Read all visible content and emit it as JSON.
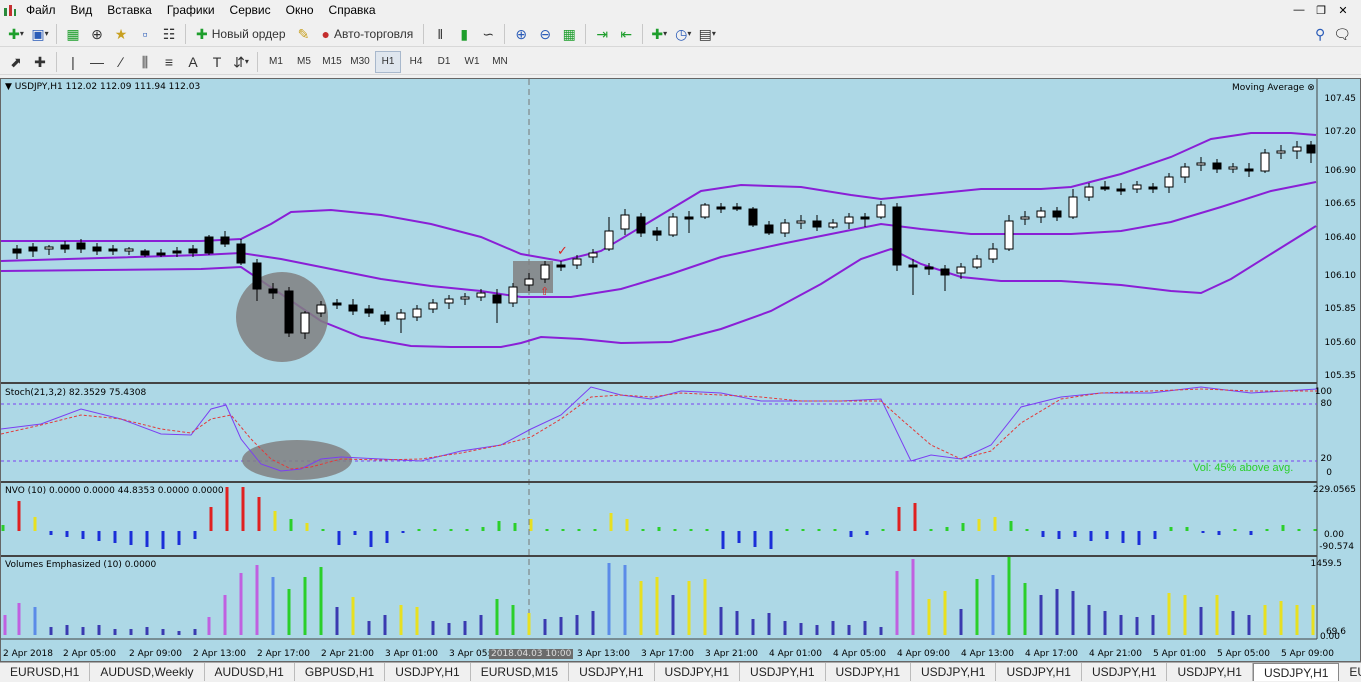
{
  "menu": [
    "Файл",
    "Вид",
    "Вставка",
    "Графики",
    "Сервис",
    "Окно",
    "Справка"
  ],
  "toolbar1": {
    "new_order": "Новый ордер",
    "autotrading": "Авто-торговля"
  },
  "timeframes": [
    "M1",
    "M5",
    "M15",
    "M30",
    "H1",
    "H4",
    "D1",
    "W1",
    "MN"
  ],
  "active_timeframe": "H1",
  "chart": {
    "header": "USDJPY,H1  112.02 112.09 111.94 112.03",
    "indicator_name": "Moving Average",
    "price_levels": [
      "107.45",
      "107.20",
      "106.90",
      "106.65",
      "106.40",
      "106.10",
      "105.85",
      "105.60",
      "105.35"
    ],
    "stoch_label": "Stoch(21,3,2) 82.3529 75.4308",
    "stoch_levels": [
      "100",
      "80",
      "20",
      "0"
    ],
    "vol_text": "Vol:  45% above avg.",
    "nvo_label": "NVO (10) 0.0000 0.0000 44.8353 0.0000 0.0000",
    "nvo_levels": [
      "229.0565",
      "0.00",
      "-90.574"
    ],
    "vol_label": "Volumes Emphasized  (10)  0.0000",
    "vol_levels": [
      "1459.5",
      "69.6",
      "0.00"
    ],
    "time_labels": [
      "2 Apr 2018",
      "2 Apr 05:00",
      "2 Apr 09:00",
      "2 Apr 13:00",
      "2 Apr 17:00",
      "2 Apr 21:00",
      "3 Apr 01:00",
      "3 Apr 05:",
      "2018.04.03 10:00",
      "3 Apr 13:00",
      "3 Apr 17:00",
      "3 Apr 21:00",
      "4 Apr 01:00",
      "4 Apr 05:00",
      "4 Apr 09:00",
      "4 Apr 13:00",
      "4 Apr 17:00",
      "4 Apr 21:00",
      "5 Apr 01:00",
      "5 Apr 05:00",
      "5 Apr 09:00"
    ]
  },
  "tabs": [
    "EURUSD,H1",
    "AUDUSD,Weekly",
    "AUDUSD,H1",
    "GBPUSD,H1",
    "USDJPY,H1",
    "EURUSD,M15",
    "USDJPY,H1",
    "USDJPY,H1",
    "USDJPY,H1",
    "USDJPY,H1",
    "USDJPY,H1",
    "USDJPY,H1",
    "USDJPY,H1",
    "USDJPY,H1",
    "USDJPY,H1",
    "EURUSD,H"
  ],
  "active_tab": 14,
  "colors": {
    "background": "#add8e6",
    "bands": "#8a1fd6",
    "stoch_main": "#7b3ff2",
    "stoch_signal": "#e23b3b",
    "vol_text": "#2bcf2b"
  }
}
